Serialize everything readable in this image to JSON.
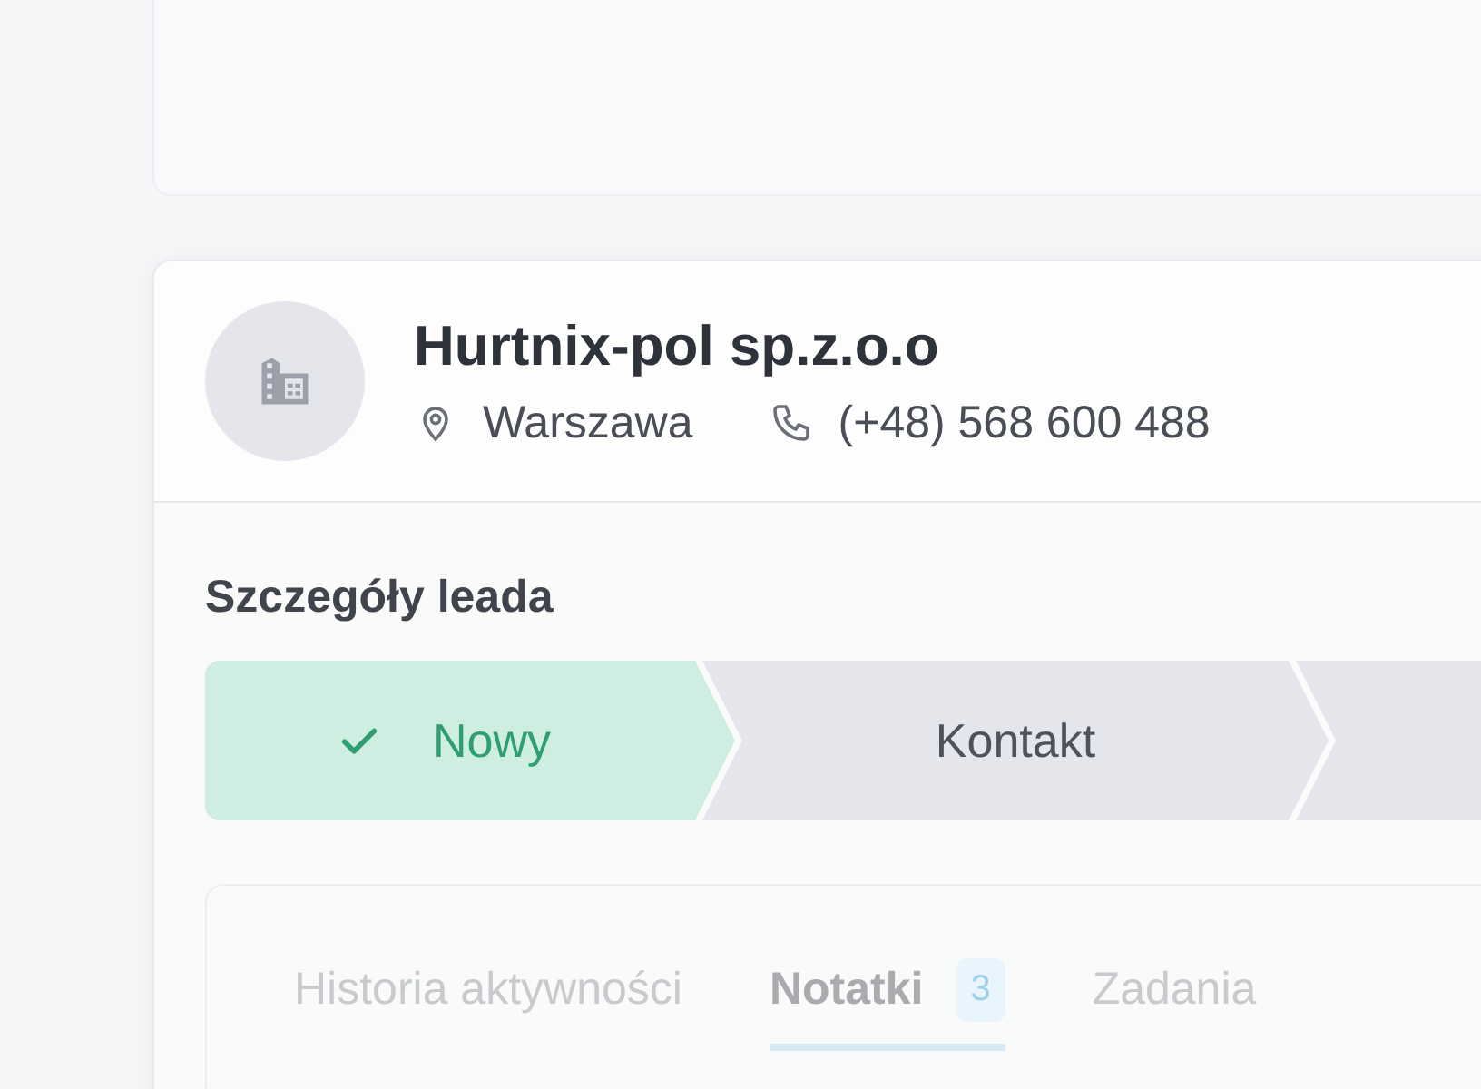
{
  "company": {
    "name": "Hurtnix-pol sp.z.o.o",
    "city": "Warszawa",
    "phone": "(+48) 568 600 488"
  },
  "details": {
    "title": "Szczegóły leada",
    "stages": [
      {
        "label": "Nowy",
        "done": true
      },
      {
        "label": "Kontakt",
        "done": false
      },
      {
        "done": false
      }
    ]
  },
  "tabs": [
    {
      "label": "Historia aktywności",
      "selected": false
    },
    {
      "label": "Notatki",
      "selected": true,
      "count": "3"
    },
    {
      "label": "Zadania",
      "selected": false
    }
  ]
}
